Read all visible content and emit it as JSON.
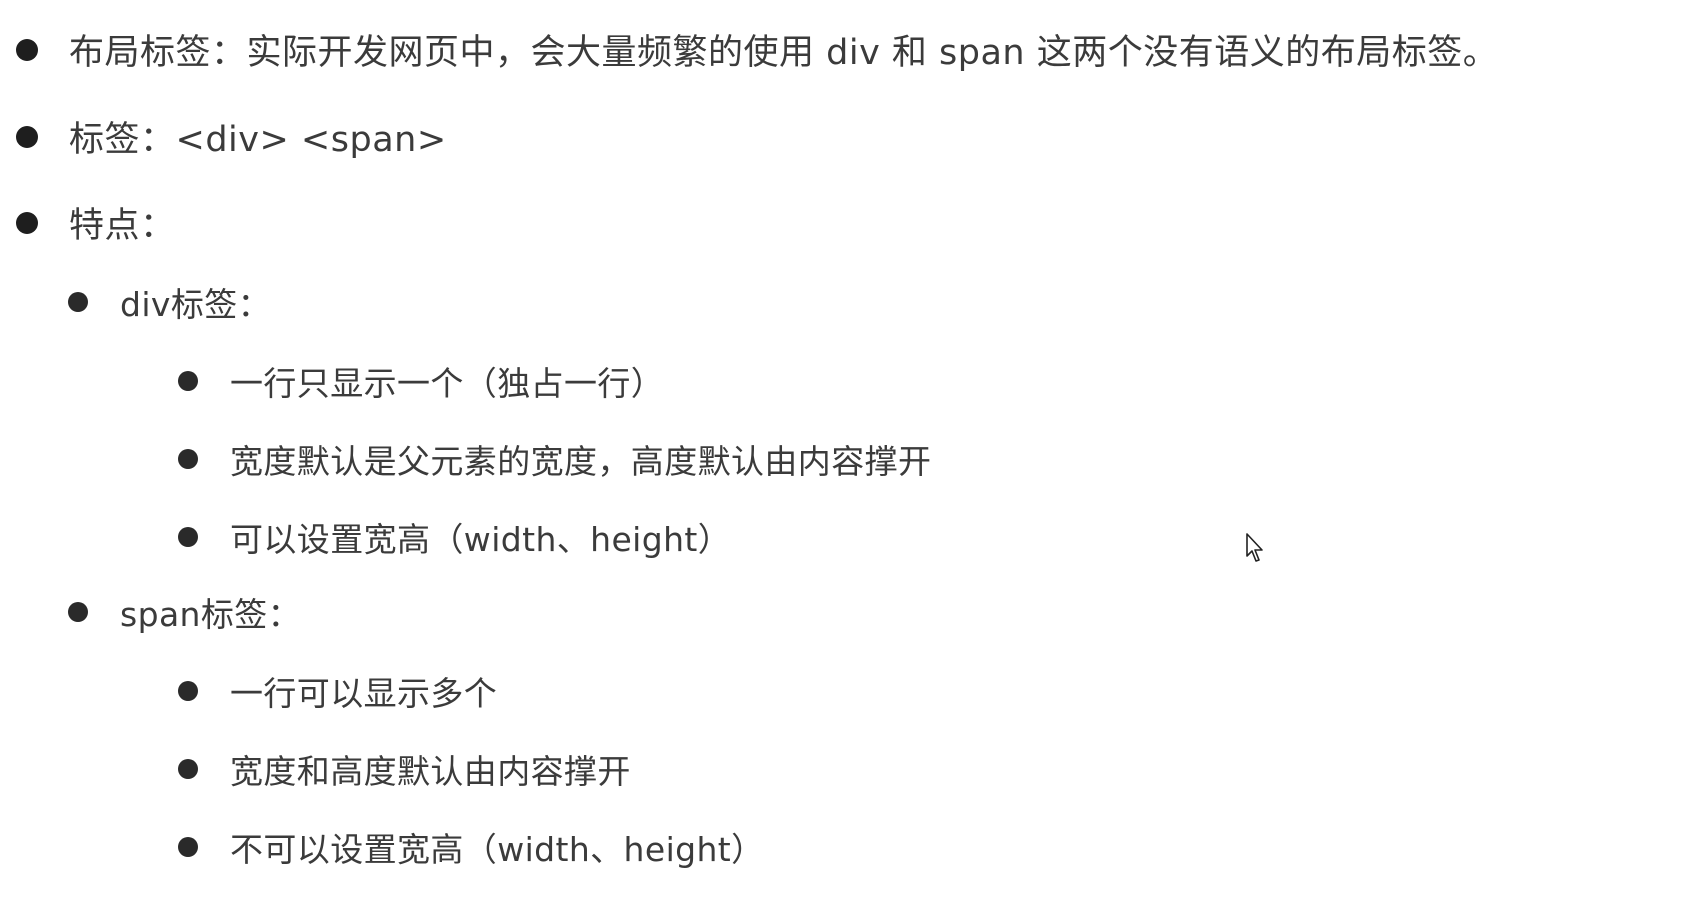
{
  "items": [
    {
      "level": 1,
      "text": "布局标签：实际开发网页中，会大量频繁的使用 div 和 span 这两个没有语义的布局标签。"
    },
    {
      "level": 1,
      "text": "标签：<div>  <span>"
    },
    {
      "level": 1,
      "text": "特点："
    },
    {
      "level": 2,
      "text": "div标签："
    },
    {
      "level": 3,
      "text": "一行只显示一个（独占一行）"
    },
    {
      "level": 3,
      "text": "宽度默认是父元素的宽度，高度默认由内容撑开"
    },
    {
      "level": 3,
      "text": "可以设置宽高（width、height）"
    },
    {
      "level": 2,
      "text": "span标签："
    },
    {
      "level": 3,
      "text": "一行可以显示多个"
    },
    {
      "level": 3,
      "text": "宽度和高度默认由内容撑开"
    },
    {
      "level": 3,
      "text": "不可以设置宽高（width、height）"
    }
  ],
  "colors": {
    "text": "#3b3b3b",
    "bullet": "#1e1e1e",
    "background": "#ffffff"
  },
  "icons": {
    "bullet": "filled-circle-icon",
    "cursor": "mouse-pointer-icon"
  }
}
